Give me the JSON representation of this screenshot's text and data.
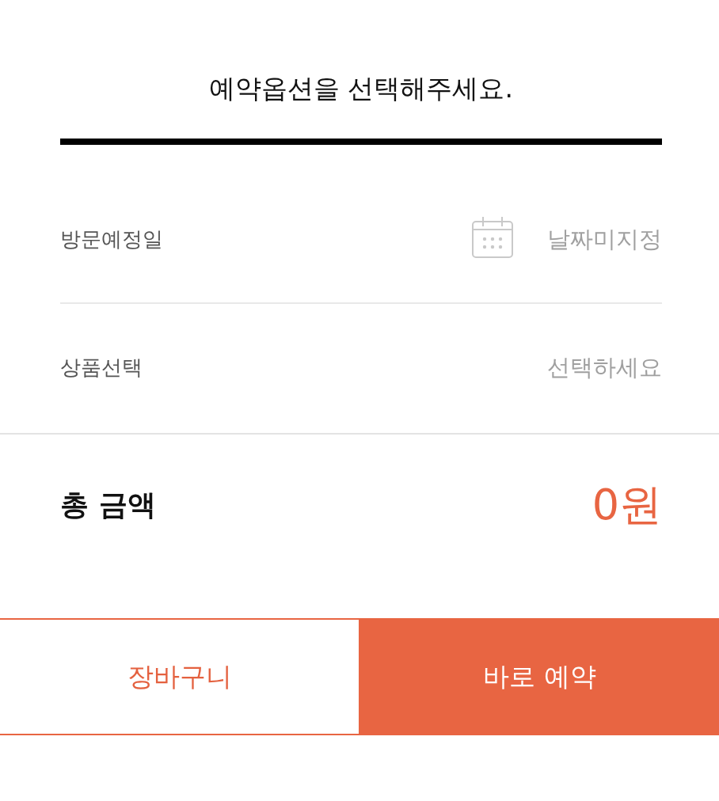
{
  "title": "예약옵션을 선택해주세요.",
  "options": [
    {
      "kind": "date",
      "label": "방문예정일",
      "placeholder": "날짜미지정"
    },
    {
      "kind": "select",
      "label": "상품선택",
      "placeholder": "선택하세요"
    }
  ],
  "total": {
    "label": "총 금액",
    "amount": "0원"
  },
  "buttons": [
    {
      "kind": "outline",
      "label": "장바구니"
    },
    {
      "kind": "primary",
      "label": "바로 예약"
    }
  ]
}
